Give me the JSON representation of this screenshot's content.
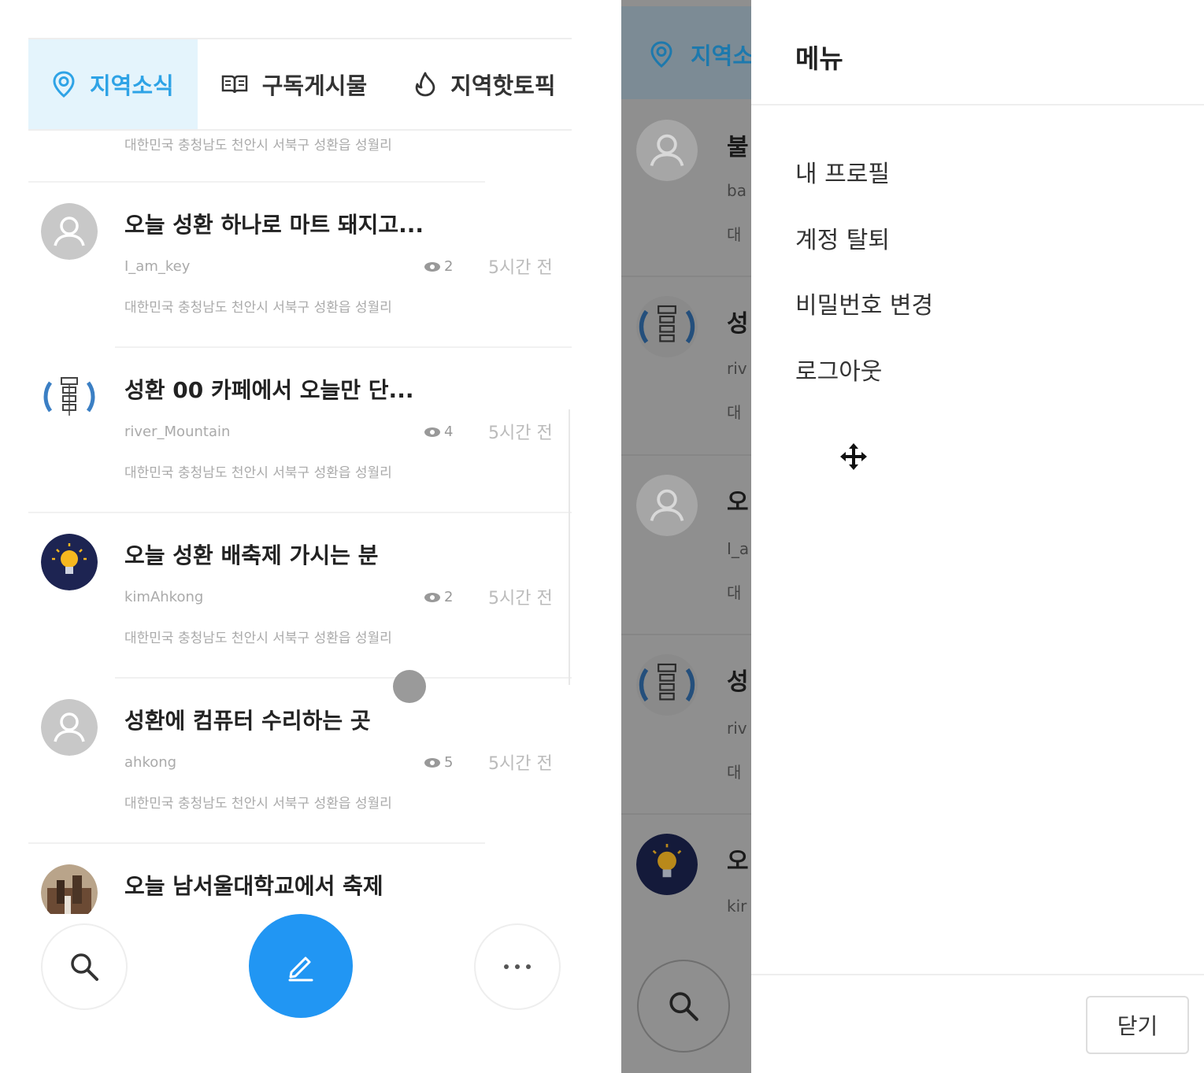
{
  "tabs": [
    {
      "label": "지역소식",
      "icon": "location-pin-icon",
      "active": true
    },
    {
      "label": "구독게시물",
      "icon": "open-book-icon",
      "active": false
    },
    {
      "label": "지역핫토픽",
      "icon": "flame-icon",
      "active": false
    }
  ],
  "partial_location": "대한민국 충청남도 천안시 서북구 성환읍 성월리",
  "posts": [
    {
      "title": "오늘 성환 하나로 마트 돼지고...",
      "author": "I_am_key",
      "views": "2",
      "time": "5시간 전",
      "location": "대한민국 충청남도 천안시 서북구 성환읍 성월리",
      "avatar": "default"
    },
    {
      "title": "성환 00 카페에서 오늘만 단...",
      "author": "river_Mountain",
      "views": "4",
      "time": "5시간 전",
      "location": "대한민국 충청남도 천안시 서북구 성환읍 성월리",
      "avatar": "diagram"
    },
    {
      "title": "오늘 성환 배축제 가시는 분",
      "author": "kimAhkong",
      "views": "2",
      "time": "5시간 전",
      "location": "대한민국 충청남도 천안시 서북구 성환읍 성월리",
      "avatar": "bulb"
    },
    {
      "title": "성환에 컴퓨터 수리하는 곳",
      "author": "ahkong",
      "views": "5",
      "time": "5시간 전",
      "location": "대한민국 충청남도 천안시 서북구 성환읍 성월리",
      "avatar": "default"
    },
    {
      "title": "오늘 남서울대학교에서 축제",
      "author": "",
      "views": "",
      "time": "",
      "location": "",
      "avatar": "photo"
    }
  ],
  "bottom_bar": {
    "search_icon": "search-icon",
    "write_icon": "pencil-icon",
    "more_icon": "more-dots-icon"
  },
  "colors": {
    "accent": "#2196f3",
    "tab_active_bg": "#e4f4fc",
    "tab_active_text": "#2ea3e6",
    "overlay": "#8f8f8f"
  },
  "right_screen": {
    "visible_tab": "지역소",
    "items": [
      {
        "title": "불",
        "line1": "ba",
        "line2": "대",
        "avatar": "default"
      },
      {
        "title": "성",
        "line1": "riv",
        "line2": "대",
        "avatar": "diagram"
      },
      {
        "title": "오",
        "line1": "I_a",
        "line2": "대",
        "avatar": "default"
      },
      {
        "title": "성",
        "line1": "riv",
        "line2": "대",
        "avatar": "diagram"
      },
      {
        "title": "오",
        "line1": "kir",
        "line2": "",
        "avatar": "bulb"
      }
    ]
  },
  "drawer": {
    "title": "메뉴",
    "items": [
      "내 프로필",
      "계정 탈퇴",
      "비밀번호 변경",
      "로그아웃"
    ],
    "close_label": "닫기"
  }
}
